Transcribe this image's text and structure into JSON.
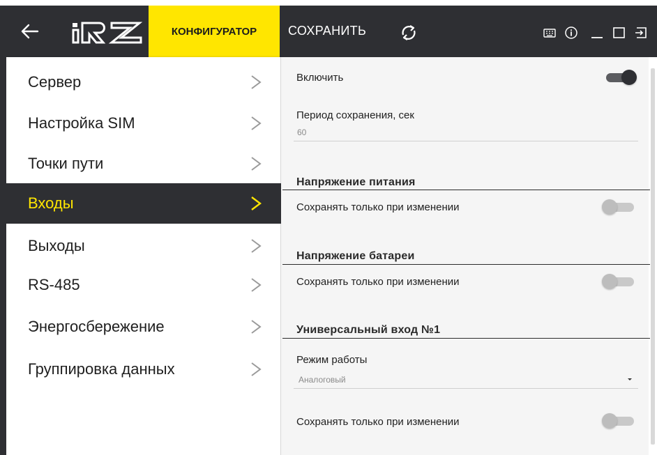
{
  "header": {
    "tab_config": "КОНФИГУРАТОР",
    "save_label": "СОХРАНИТЬ"
  },
  "colors": {
    "accent": "#ffe600",
    "dark": "#2e2f33"
  },
  "icons": [
    "back-arrow-icon",
    "irz-logo",
    "sync-icon",
    "keyboard-icon",
    "info-icon",
    "minimize-icon",
    "maximize-icon",
    "exit-icon"
  ],
  "sidebar": {
    "items": [
      {
        "label": "Сервер",
        "active": false
      },
      {
        "label": "Настройка SIM",
        "active": false
      },
      {
        "label": "Точки пути",
        "active": false
      },
      {
        "label": "Входы",
        "active": true
      },
      {
        "label": "Выходы",
        "active": false
      },
      {
        "label": "RS-485",
        "active": false
      },
      {
        "label": "Энергосбережение",
        "active": false
      },
      {
        "label": "Группировка данных",
        "active": false
      }
    ]
  },
  "content": {
    "enable_label": "Включить",
    "enable_on": true,
    "period_label": "Период сохранения, сек",
    "period_value": "60",
    "sections": [
      {
        "title": "Напряжение питания",
        "toggle_label": "Сохранять только при изменении",
        "toggle_on": false
      },
      {
        "title": "Напряжение батареи",
        "toggle_label": "Сохранять только при изменении",
        "toggle_on": false
      },
      {
        "title": "Универсальный вход №1",
        "mode_label": "Режим работы",
        "mode_value": "Аналоговый",
        "toggle_label": "Сохранять только при изменении",
        "toggle_on": false
      }
    ]
  }
}
